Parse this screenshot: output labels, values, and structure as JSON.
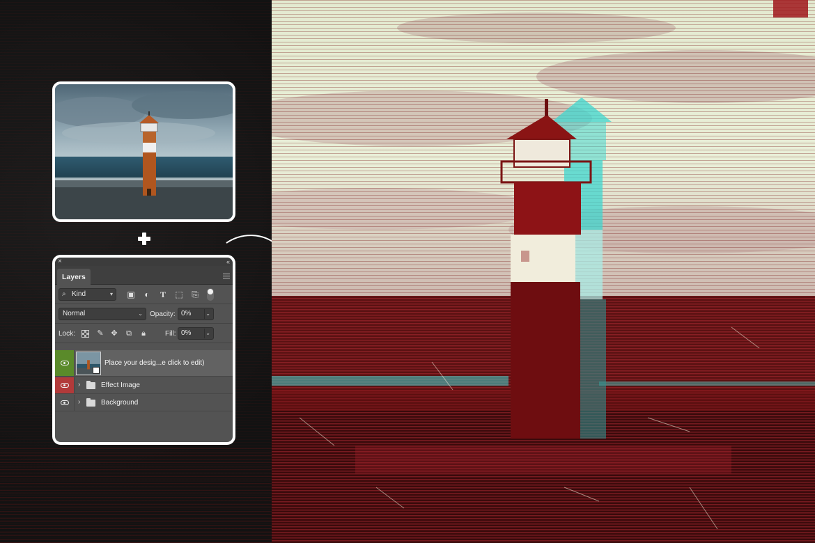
{
  "layers_panel": {
    "close_glyph": "×",
    "collapse_glyph": "«",
    "tab_label": "Layers",
    "filter": {
      "kind_label": "Kind"
    },
    "blend_mode": "Normal",
    "opacity_label": "Opacity:",
    "opacity_value": "0%",
    "lock_label": "Lock:",
    "fill_label": "Fill:",
    "fill_value": "0%",
    "layers": [
      {
        "label": "Place your desig...e click to edit)",
        "type": "smart-object",
        "visibility_color": "#5a8a2a"
      },
      {
        "label": "Effect Image",
        "type": "group",
        "visibility_color": "#b23a3a"
      },
      {
        "label": "Background",
        "type": "group"
      }
    ]
  },
  "icons": {
    "plus": "plus-icon",
    "arrow": "curved-arrow-icon",
    "filter_icons": [
      "image-filter-icon",
      "adjustment-filter-icon",
      "type-filter-icon",
      "shape-filter-icon",
      "smart-object-filter-icon"
    ],
    "lock_icons": [
      "lock-transparent-icon",
      "lock-brush-icon",
      "lock-move-icon",
      "lock-artboard-icon",
      "lock-all-icon"
    ]
  },
  "colors": {
    "background": "#161616",
    "panel": "#535353",
    "effect_red": "#8a1010",
    "effect_cyan": "#3fd6cf",
    "effect_cream": "#e9efd6"
  }
}
